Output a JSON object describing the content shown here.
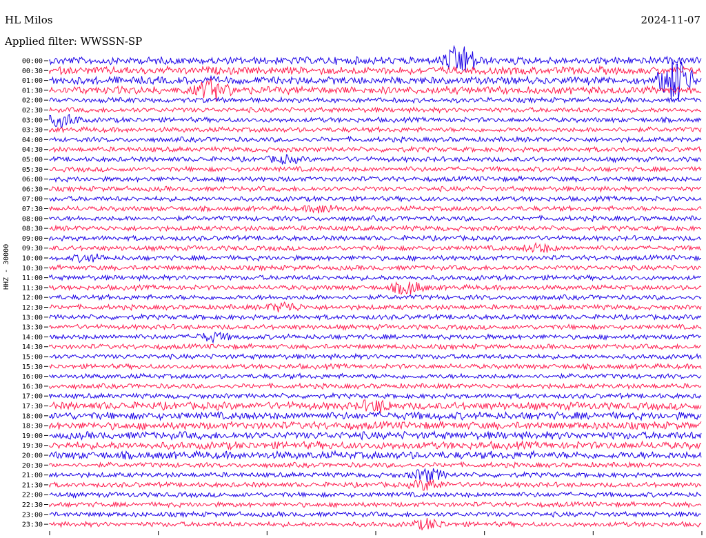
{
  "header": {
    "station": "HL Milos",
    "filter": "Applied filter: WWSSN-SP",
    "date": "2024-11-07"
  },
  "channel_label": "HHZ - 30000",
  "colors": {
    "trace_a": "#1a00e6",
    "trace_b": "#ff1a4d",
    "background": "#ffffff"
  },
  "chart_data": {
    "type": "line",
    "title": "HL Milos",
    "subtitle": "Applied filter: WWSSN-SP",
    "ylabel": "HHZ - 30000",
    "xlabel": "",
    "row_labels": [
      "00:00",
      "00:30",
      "01:00",
      "01:30",
      "02:00",
      "02:30",
      "03:00",
      "03:30",
      "04:00",
      "04:30",
      "05:00",
      "05:30",
      "06:00",
      "06:30",
      "07:00",
      "07:30",
      "08:00",
      "08:30",
      "09:00",
      "09:30",
      "10:00",
      "10:30",
      "11:00",
      "11:30",
      "12:00",
      "12:30",
      "13:00",
      "13:30",
      "14:00",
      "14:30",
      "15:00",
      "15:30",
      "16:00",
      "16:30",
      "17:00",
      "17:30",
      "18:00",
      "18:30",
      "19:00",
      "19:30",
      "20:00",
      "20:30",
      "21:00",
      "21:30",
      "22:00",
      "22:30",
      "23:00",
      "23:30"
    ],
    "row_colors": [
      "blue",
      "red"
    ],
    "events": [
      {
        "row": 0,
        "t": 0.63,
        "amp": 4,
        "color": "blue"
      },
      {
        "row": 2,
        "t": 0.96,
        "amp": 6,
        "color": "red"
      },
      {
        "row": 3,
        "t": 0.25,
        "amp": 2.5,
        "color": "blue"
      },
      {
        "row": 6,
        "t": 0.02,
        "amp": 2.5,
        "color": "red"
      },
      {
        "row": 10,
        "t": 0.36,
        "amp": 1.2,
        "color": "blue"
      },
      {
        "row": 15,
        "t": 0.42,
        "amp": 1.5,
        "color": "red"
      },
      {
        "row": 19,
        "t": 0.75,
        "amp": 1.5,
        "color": "red"
      },
      {
        "row": 20,
        "t": 0.06,
        "amp": 1.2,
        "color": "blue"
      },
      {
        "row": 23,
        "t": 0.55,
        "amp": 2.5,
        "color": "blue"
      },
      {
        "row": 25,
        "t": 0.36,
        "amp": 1.8,
        "color": "red"
      },
      {
        "row": 28,
        "t": 0.25,
        "amp": 1.5,
        "color": "red"
      },
      {
        "row": 35,
        "t": 0.5,
        "amp": 1.2,
        "color": "red"
      },
      {
        "row": 42,
        "t": 0.58,
        "amp": 2.5,
        "color": "red"
      },
      {
        "row": 43,
        "t": 0.58,
        "amp": 2.0,
        "color": "red"
      },
      {
        "row": 47,
        "t": 0.58,
        "amp": 1.8,
        "color": "red"
      }
    ]
  }
}
